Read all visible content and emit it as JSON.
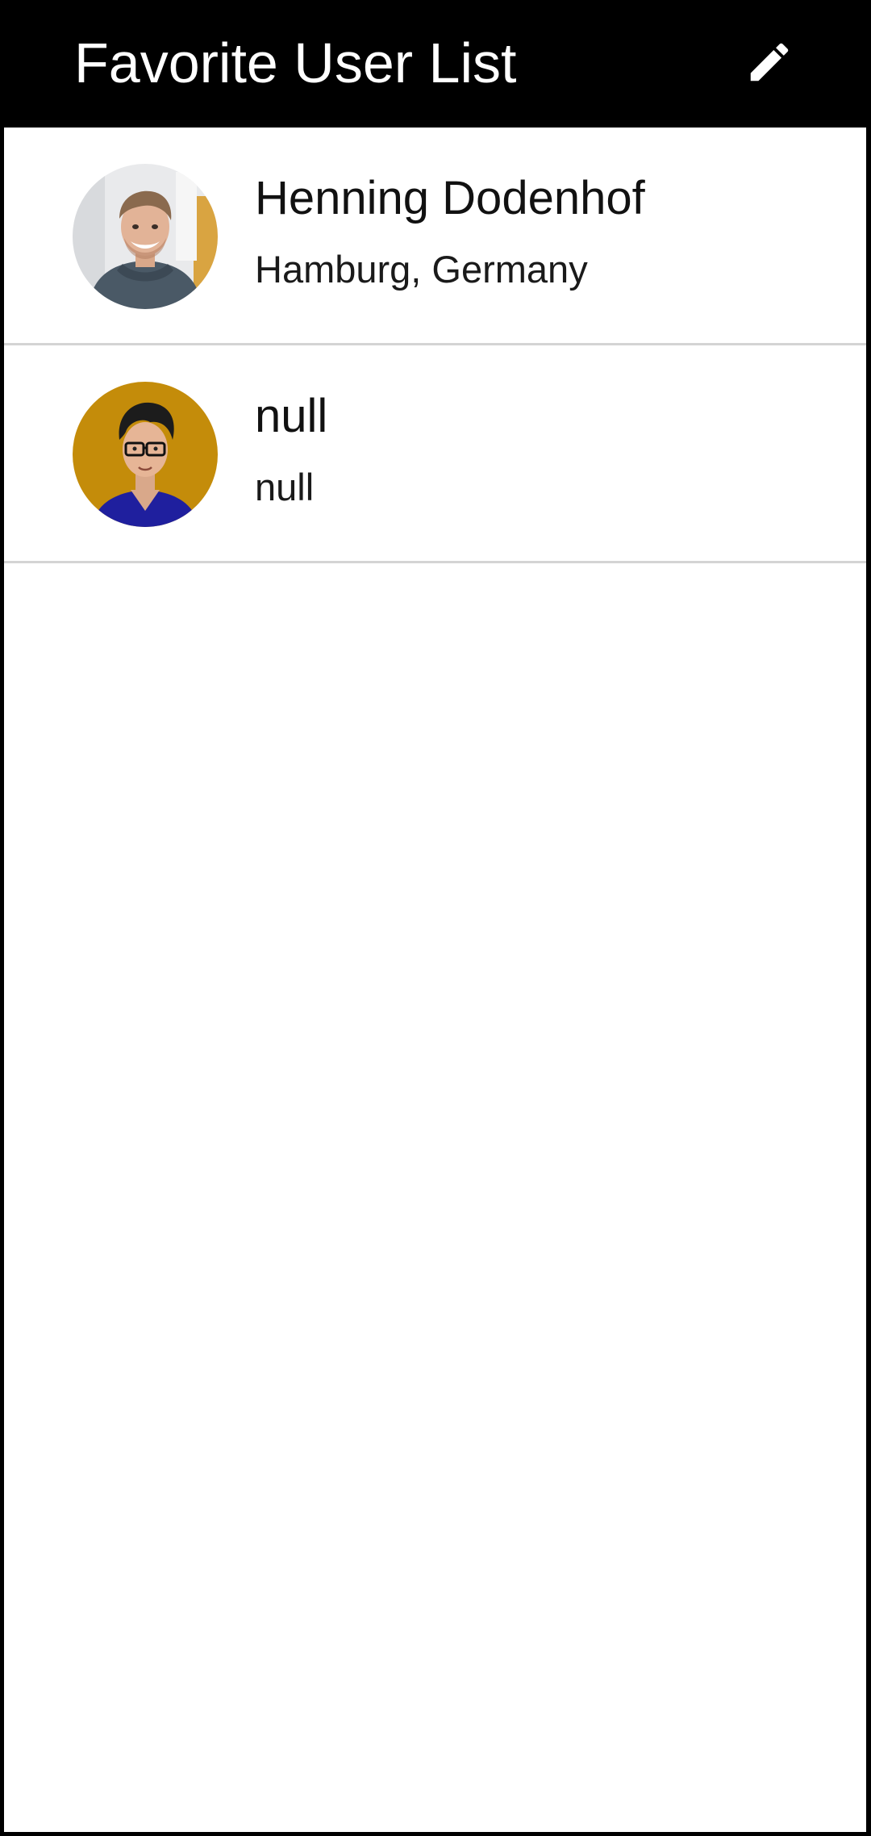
{
  "app_bar": {
    "title": "Favorite User List",
    "action_icon": "edit-icon"
  },
  "users": [
    {
      "name": "Henning Dodenhof",
      "location": "Hamburg, Germany",
      "avatar": "photo-avatar"
    },
    {
      "name": "null",
      "location": "null",
      "avatar": "illustrated-avatar"
    }
  ],
  "colors": {
    "app_bar_background": "#000000",
    "app_bar_text": "#ffffff",
    "list_background": "#ffffff",
    "divider": "#d4d4d4",
    "primary_text": "#111111"
  }
}
